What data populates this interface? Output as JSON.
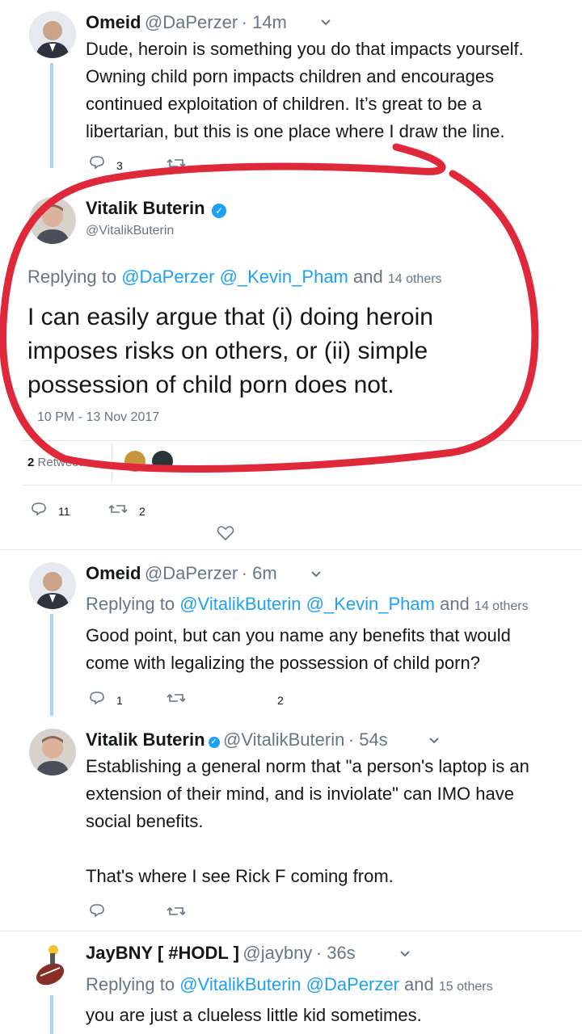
{
  "tweet1": {
    "name": "Omeid",
    "handle": "@DaPerzer",
    "time": "· 14m",
    "text_lines": [
      "Dude, heroin is something you do that impacts yourself.",
      "Owning child porn impacts children and encourages",
      "continued exploitation of children. It’s great to be a",
      "libertarian, but this is one place where I draw the line."
    ],
    "reply_count": "3"
  },
  "main": {
    "name": "Vitalik Buterin",
    "handle": "@VitalikButerin",
    "replying_label": "Replying to",
    "replying_handles": "@DaPerzer @_Kevin_Pham",
    "replying_and": "and",
    "replying_others": "14 others",
    "text_lines": [
      "I can easily argue that (i) doing heroin",
      "imposes risks on others, or (ii) simple",
      "possession of child porn does not."
    ],
    "timestamp": "10 PM - 13 Nov 2017",
    "retweets_count": "2",
    "retweets_label": "Retweets",
    "reply_count": "11",
    "retweet_count": "2"
  },
  "tweet3": {
    "name": "Omeid",
    "handle": "@DaPerzer",
    "time": "· 6m",
    "replying_label": "Replying to",
    "replying_handles": "@VitalikButerin @_Kevin_Pham",
    "replying_and": "and",
    "replying_others": "14 others",
    "text_lines": [
      "Good point, but can you name any benefits that would",
      "come with legalizing the possession of child porn?"
    ],
    "reply_count": "1",
    "like_count": "2"
  },
  "tweet4": {
    "name": "Vitalik Buterin",
    "handle": "@VitalikButerin",
    "time": "· 54s",
    "text_lines": [
      "Establishing a general norm that \"a person's laptop is an",
      "extension of their mind, and is inviolate\" can IMO have",
      "social benefits.",
      "",
      "That's where I see Rick F coming from."
    ]
  },
  "tweet5": {
    "name": "JayBNY [ #HODL ]",
    "handle": "@jaybny",
    "time": "· 36s",
    "replying_label": "Replying to",
    "replying_handles": "@VitalikButerin @DaPerzer",
    "replying_and": "and",
    "replying_others": "15 others",
    "text_lines": [
      "you are just a clueless little kid sometimes."
    ]
  },
  "colors": {
    "link": "#1da1f2",
    "muted": "#657786",
    "annotation": "#e0283b",
    "thread": "#a9d4ef"
  },
  "icons": [
    "reply-icon",
    "retweet-icon",
    "like-icon",
    "chevron-down-icon",
    "verified-badge-icon"
  ]
}
